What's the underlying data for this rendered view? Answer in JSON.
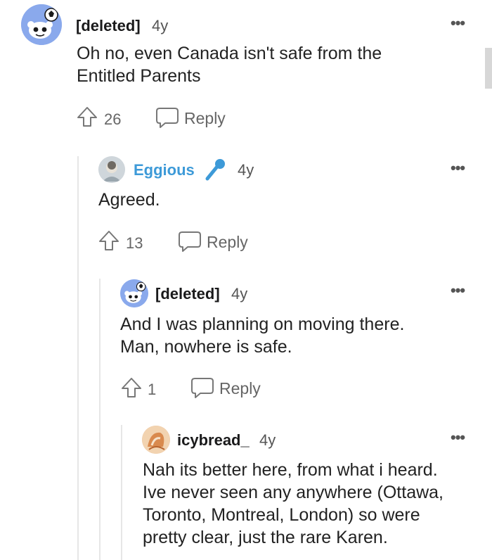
{
  "comments": [
    {
      "username": "[deleted]",
      "age": "4y",
      "text_lines": [
        "Oh no, even Canada isn't safe from the",
        "Entitled Parents"
      ],
      "upvotes": "26",
      "reply_label": "Reply",
      "menu_icon": "more-icon"
    },
    {
      "username": "Eggious",
      "age": "4y",
      "text_lines": [
        "Agreed."
      ],
      "upvotes": "13",
      "reply_label": "Reply",
      "flair_icon": "microphone-icon",
      "username_color": "#3d9ad8"
    },
    {
      "username": "[deleted]",
      "age": "4y",
      "text_lines": [
        "And I was planning on moving there.",
        "Man, nowhere is safe."
      ],
      "upvotes": "1",
      "reply_label": "Reply"
    },
    {
      "username": "icybread_",
      "age": "4y",
      "text_lines": [
        "Nah its better here, from what i heard.",
        "Ive never seen any anywhere (Ottawa,",
        "Toronto, Montreal, London) so were",
        "pretty clear, just the rare Karen."
      ]
    }
  ]
}
